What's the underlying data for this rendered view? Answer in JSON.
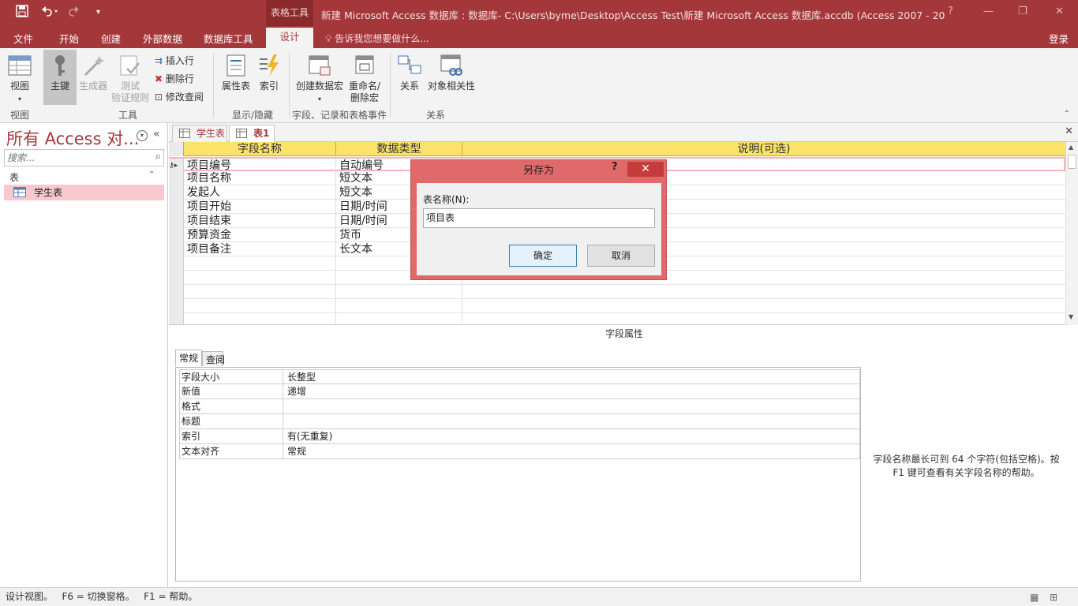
{
  "titlebar": {
    "context_tools": "表格工具",
    "title": "新建 Microsoft Access 数据库 : 数据库- C:\\Users\\byme\\Desktop\\Access Test\\新建 Microsoft Access 数据库.accdb (Access 2007 - 20...",
    "help": "?",
    "minimize": "—",
    "restore": "❐",
    "close": "✕"
  },
  "tabs": {
    "file": "文件",
    "home": "开始",
    "create": "创建",
    "external": "外部数据",
    "dbtools": "数据库工具",
    "design": "设计",
    "tellme": "告诉我您想要做什么...",
    "signin": "登录"
  },
  "ribbon": {
    "view": "视图",
    "primary_key": "主键",
    "builder": "生成器",
    "test_rules_1": "测试",
    "test_rules_2": "验证规则",
    "insert_row": "插入行",
    "delete_row": "删除行",
    "modify_lookup": "修改查阅",
    "property_sheet": "属性表",
    "indexes": "索引",
    "create_macro": "创建数据宏",
    "rename_macro_1": "重命名/",
    "rename_macro_2": "删除宏",
    "relationships": "关系",
    "object_deps": "对象相关性",
    "groups": {
      "view": "视图",
      "tools": "工具",
      "show_hide": "显示/隐藏",
      "events": "字段、记录和表格事件",
      "relations": "关系"
    }
  },
  "nav": {
    "title": "所有 Access 对...",
    "search_placeholder": "搜索...",
    "group": "表",
    "items": [
      "学生表"
    ]
  },
  "doc_tabs": [
    "学生表",
    "表1"
  ],
  "grid": {
    "headers": [
      "字段名称",
      "数据类型",
      "说明(可选)"
    ],
    "rows": [
      {
        "name": "项目编号",
        "type": "自动编号"
      },
      {
        "name": "项目名称",
        "type": "短文本"
      },
      {
        "name": "发起人",
        "type": "短文本"
      },
      {
        "name": "项目开始",
        "type": "日期/时间"
      },
      {
        "name": "项目结束",
        "type": "日期/时间"
      },
      {
        "name": "预算资金",
        "type": "货币"
      },
      {
        "name": "项目备注",
        "type": "长文本"
      }
    ]
  },
  "field_props": {
    "label": "字段属性",
    "tabs": [
      "常规",
      "查阅"
    ],
    "rows": [
      {
        "k": "字段大小",
        "v": "长整型"
      },
      {
        "k": "新值",
        "v": "递增"
      },
      {
        "k": "格式",
        "v": ""
      },
      {
        "k": "标题",
        "v": ""
      },
      {
        "k": "索引",
        "v": "有(无重复)"
      },
      {
        "k": "文本对齐",
        "v": "常规"
      }
    ],
    "help_text": "字段名称最长可到 64 个字符(包括空格)。按 F1 键可查看有关字段名称的帮助。"
  },
  "dialog": {
    "title": "另存为",
    "help": "?",
    "label": "表名称(N):",
    "value": "项目表",
    "ok": "确定",
    "cancel": "取消"
  },
  "status": {
    "text": "设计视图。   F6 = 切换窗格。   F1 = 帮助。"
  },
  "colors": {
    "accent": "#a4373a",
    "header_yellow": "#fbe26b",
    "selection": "#f7c8cc"
  }
}
